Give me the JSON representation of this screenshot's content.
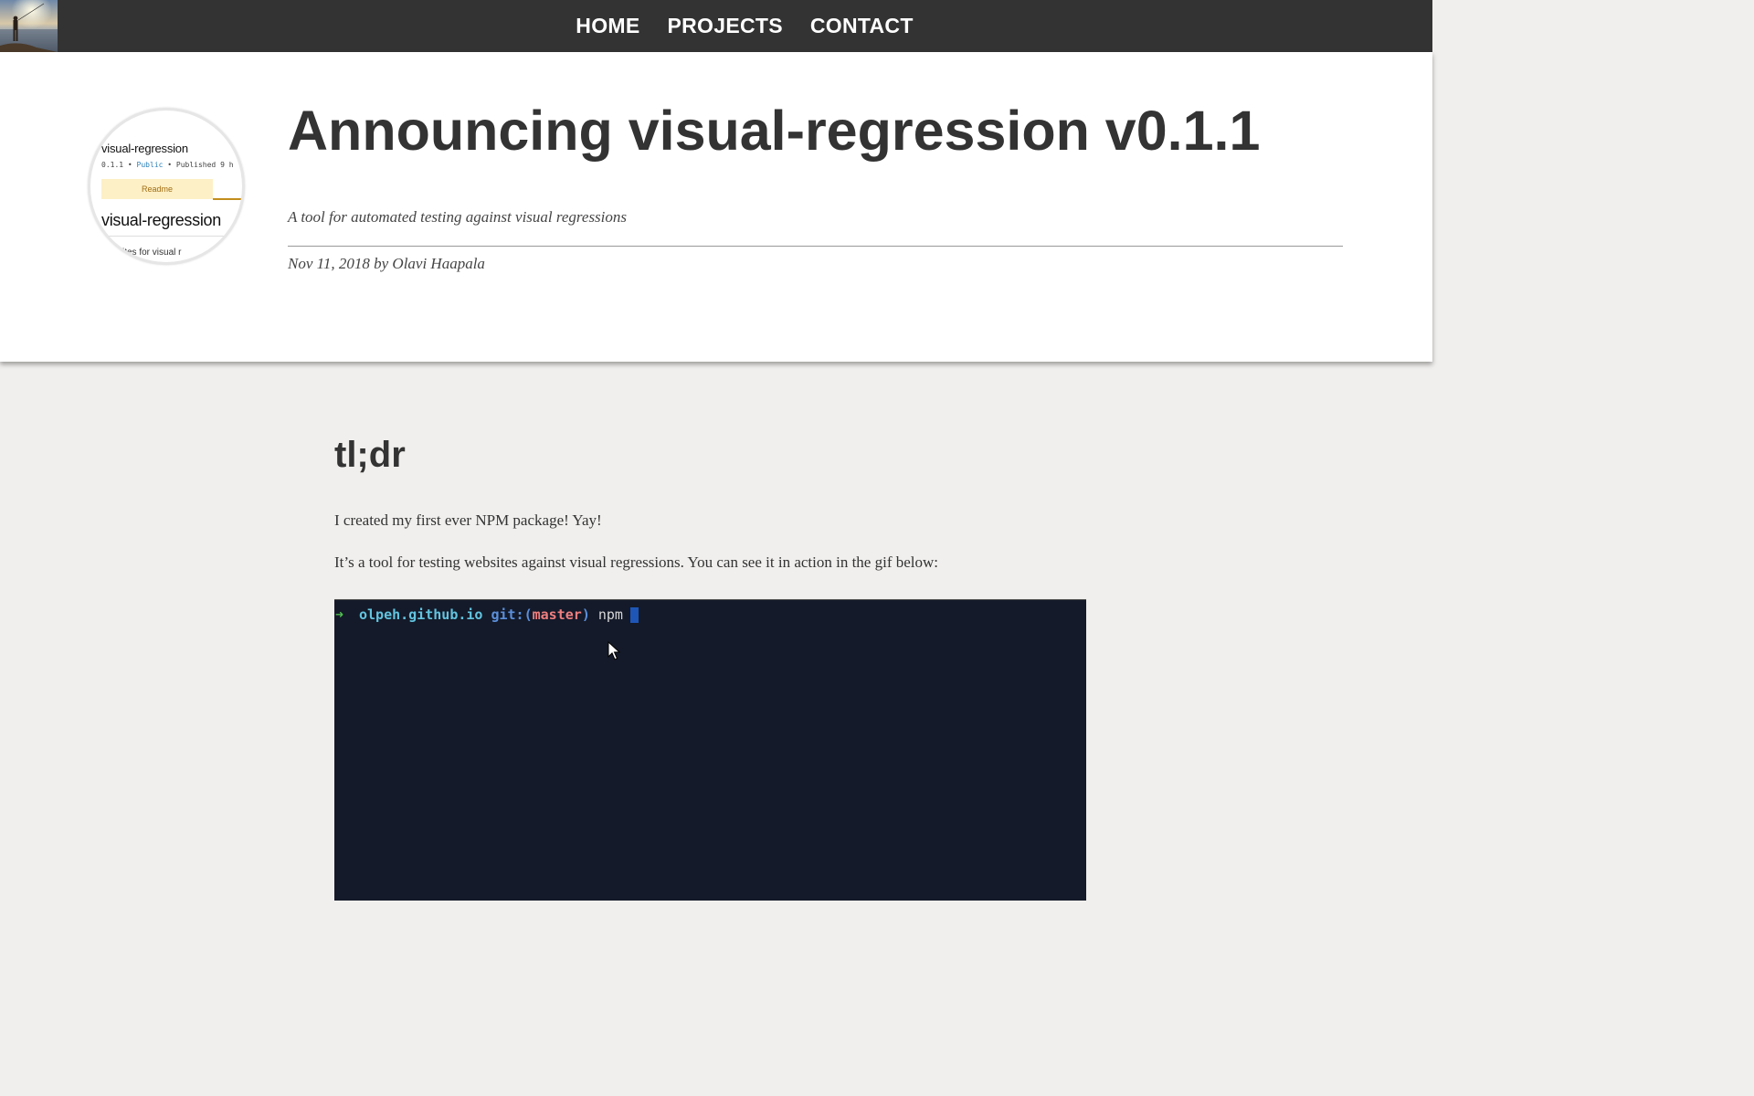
{
  "nav": {
    "items": [
      {
        "label": "HOME"
      },
      {
        "label": "PROJECTS"
      },
      {
        "label": "CONTACT"
      }
    ]
  },
  "header": {
    "title": "Announcing visual-regression v0.1.1",
    "subtitle": "A tool for automated testing against visual regressions",
    "byline": "Nov 11, 2018 by Olavi Haapala"
  },
  "thumbnail": {
    "package_name": "visual-regression",
    "version": "0.1.1",
    "sep1": " • ",
    "visibility": "Public",
    "published": " • Published 9 h",
    "tab_label": "Readme",
    "big_name": "visual-regression",
    "desc_fragment": "sites for visual r"
  },
  "content": {
    "heading": "tl;dr",
    "paragraphs": [
      "I created my first ever NPM package! Yay!",
      "It’s a tool for testing websites against visual regressions. You can see it in action in the gif below:"
    ]
  },
  "terminal": {
    "prompt_arrow": "➜",
    "host": "olpeh.github.io",
    "git_label": "git:",
    "paren_open": "(",
    "branch": "master",
    "paren_close": ")",
    "command": "npm"
  },
  "colors": {
    "nav_bg": "#333333",
    "page_bg": "#f0efed",
    "terminal_bg": "#141a29",
    "branch": "#f07f7f",
    "host": "#62c4e0"
  }
}
